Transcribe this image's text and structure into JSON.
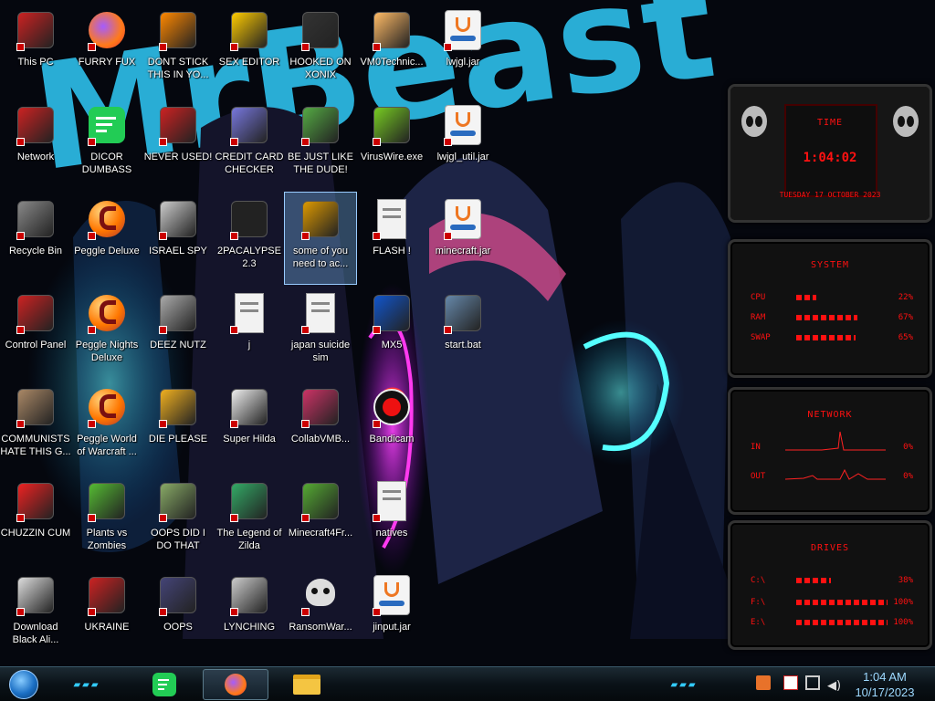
{
  "desktop": {
    "icons": [
      {
        "label": "This PC",
        "col": 0,
        "row": 0,
        "glyph": "computer",
        "color": "#c22"
      },
      {
        "label": "Network",
        "col": 0,
        "row": 1,
        "glyph": "network",
        "color": "#c22"
      },
      {
        "label": "Recycle Bin",
        "col": 0,
        "row": 2,
        "glyph": "recycle",
        "color": "#888"
      },
      {
        "label": "Control Panel",
        "col": 0,
        "row": 3,
        "glyph": "panel",
        "color": "#c22"
      },
      {
        "label": "COMMUNISTS HATE THIS G...",
        "col": 0,
        "row": 4,
        "glyph": "moneybag",
        "color": "#a86"
      },
      {
        "label": "CHUZZIN CUM",
        "col": 0,
        "row": 5,
        "glyph": "chuzzle",
        "color": "#e22"
      },
      {
        "label": "Download Black Ali...",
        "col": 0,
        "row": 6,
        "glyph": "download",
        "color": "#ddd"
      },
      {
        "label": "FURRY FUX",
        "col": 1,
        "row": 0,
        "glyph": "firefox",
        "color": "#f80"
      },
      {
        "label": "DICOR DUMBASS",
        "col": 1,
        "row": 1,
        "glyph": "chat",
        "color": "#2c5"
      },
      {
        "label": "Peggle Deluxe",
        "col": 1,
        "row": 2,
        "glyph": "peggle",
        "color": "#f70"
      },
      {
        "label": "Peggle Nights Deluxe",
        "col": 1,
        "row": 3,
        "glyph": "peggle",
        "color": "#f70"
      },
      {
        "label": "Peggle World of Warcraft ...",
        "col": 1,
        "row": 4,
        "glyph": "peggle",
        "color": "#f70"
      },
      {
        "label": "Plants vs Zombies",
        "col": 1,
        "row": 5,
        "glyph": "plant",
        "color": "#5b3"
      },
      {
        "label": "UKRAINE",
        "col": 1,
        "row": 6,
        "glyph": "nuke",
        "color": "#c22"
      },
      {
        "label": "DONT STICK THIS IN YO...",
        "col": 2,
        "row": 0,
        "glyph": "vlc",
        "color": "#f80"
      },
      {
        "label": "NEVER USED!",
        "col": 2,
        "row": 1,
        "glyph": "dev",
        "color": "#c22"
      },
      {
        "label": "ISRAEL SPY",
        "col": 2,
        "row": 2,
        "glyph": "card",
        "color": "#ccc"
      },
      {
        "label": "DEEZ NUTZ",
        "col": 2,
        "row": 3,
        "glyph": "stack",
        "color": "#aaa"
      },
      {
        "label": "DIE PLEASE",
        "col": 2,
        "row": 4,
        "glyph": "de",
        "color": "#f0b020"
      },
      {
        "label": "OOPS DID I DO THAT",
        "col": 2,
        "row": 5,
        "glyph": "portrait",
        "color": "#8a6"
      },
      {
        "label": "OOPS",
        "col": 2,
        "row": 6,
        "glyph": "shield",
        "color": "#447"
      },
      {
        "label": "SEX EDITOR",
        "col": 3,
        "row": 0,
        "glyph": "hxd",
        "color": "#fc0"
      },
      {
        "label": "CREDIT CARD CHECKER",
        "col": 3,
        "row": 1,
        "glyph": "card",
        "color": "#77d"
      },
      {
        "label": "2PACALYPSE 2.3",
        "col": 3,
        "row": 2,
        "glyph": "terminal",
        "color": "#222"
      },
      {
        "label": "j",
        "col": 3,
        "row": 3,
        "glyph": "file",
        "color": "#ccc"
      },
      {
        "label": "Super Hilda",
        "col": 3,
        "row": 4,
        "glyph": "pixel",
        "color": "#eee"
      },
      {
        "label": "The Legend of Zilda",
        "col": 3,
        "row": 5,
        "glyph": "pixelhero",
        "color": "#3a6"
      },
      {
        "label": "LYNCHING",
        "col": 3,
        "row": 6,
        "glyph": "rope",
        "color": "#ccc"
      },
      {
        "label": "HOOKED ON XONIX",
        "col": 4,
        "row": 0,
        "glyph": "xonix",
        "color": "#333"
      },
      {
        "label": "BE JUST LIKE THE DUDE!",
        "col": 4,
        "row": 1,
        "glyph": "santa",
        "color": "#5a4"
      },
      {
        "label": "some of you need to ac...",
        "col": 4,
        "row": 2,
        "glyph": "dog",
        "color": "#d90",
        "selected": true
      },
      {
        "label": "japan suicide sim",
        "col": 4,
        "row": 3,
        "glyph": "doc",
        "color": "#eee"
      },
      {
        "label": "CollabVMB...",
        "col": 4,
        "row": 4,
        "glyph": "monitor",
        "color": "#c36"
      },
      {
        "label": "Minecraft4Fr...",
        "col": 4,
        "row": 5,
        "glyph": "grass",
        "color": "#5a3"
      },
      {
        "label": "RansomWar...",
        "col": 4,
        "row": 6,
        "glyph": "skull",
        "color": "#ddd"
      },
      {
        "label": "VM0Technic...",
        "col": 5,
        "row": 0,
        "glyph": "doctor",
        "color": "#fb6"
      },
      {
        "label": "VirusWire.exe",
        "col": 5,
        "row": 1,
        "glyph": "lime",
        "color": "#7c2"
      },
      {
        "label": "FLASH !",
        "col": 5,
        "row": 2,
        "glyph": "file",
        "color": "#ccc"
      },
      {
        "label": "MX5",
        "col": 5,
        "row": 3,
        "glyph": "maxthon",
        "color": "#15c"
      },
      {
        "label": "Bandicam",
        "col": 5,
        "row": 4,
        "glyph": "record",
        "color": "#e11"
      },
      {
        "label": "natives",
        "col": 5,
        "row": 5,
        "glyph": "file",
        "color": "#ccc"
      },
      {
        "label": "jinput.jar",
        "col": 5,
        "row": 6,
        "glyph": "java",
        "color": "#e72"
      },
      {
        "label": "lwjgl.jar",
        "col": 6,
        "row": 0,
        "glyph": "java",
        "color": "#e72"
      },
      {
        "label": "lwjgl_util.jar",
        "col": 6,
        "row": 1,
        "glyph": "java",
        "color": "#e72"
      },
      {
        "label": "minecraft.jar",
        "col": 6,
        "row": 2,
        "glyph": "java",
        "color": "#e72"
      },
      {
        "label": "start.bat",
        "col": 6,
        "row": 3,
        "glyph": "gears",
        "color": "#68a"
      }
    ]
  },
  "widgets": {
    "time": {
      "title": "TIME",
      "clock": "1:04:02",
      "date": "TUESDAY 17 OCTOBER 2023"
    },
    "system": {
      "title": "SYSTEM",
      "rows": [
        {
          "label": "CPU",
          "value": "22%",
          "fraction": 0.22
        },
        {
          "label": "RAM",
          "value": "67%",
          "fraction": 0.67
        },
        {
          "label": "SWAP",
          "value": "65%",
          "fraction": 0.65
        }
      ]
    },
    "network": {
      "title": "NETWORK",
      "rows": [
        {
          "label": "IN",
          "value": "0%"
        },
        {
          "label": "OUT",
          "value": "0%"
        }
      ]
    },
    "drives": {
      "title": "DRIVES",
      "rows": [
        {
          "label": "C:\\",
          "value": "38%",
          "fraction": 0.38
        },
        {
          "label": "F:\\",
          "value": "100%",
          "fraction": 1.0
        },
        {
          "label": "E:\\",
          "value": "100%",
          "fraction": 1.0
        }
      ]
    }
  },
  "taskbar": {
    "start_icon": "start-orb",
    "pinned": [
      {
        "name": "chat",
        "color": "#2c5"
      },
      {
        "name": "firefox",
        "color": "#f80",
        "active": true
      },
      {
        "name": "explorer",
        "color": "#f4c542"
      }
    ],
    "tray": [
      "java-update-icon",
      "flag-icon",
      "network-icon",
      "volume-icon"
    ],
    "clock_time": "1:04 AM",
    "clock_date": "10/17/2023"
  },
  "wallpaper": {
    "title_text": "MrBeast"
  }
}
